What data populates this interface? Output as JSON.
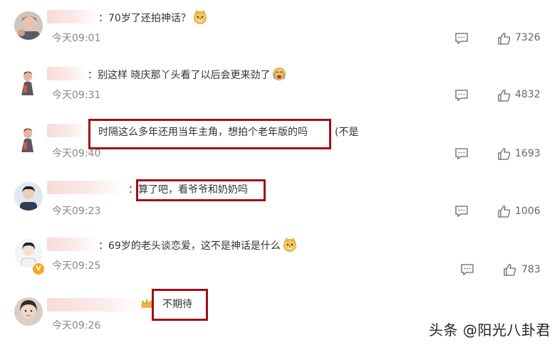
{
  "comments": [
    {
      "separator": "：",
      "text": "70岁了还拍神话？",
      "emoji": "doge-emoji",
      "time": "今天09:01",
      "likes": "7326"
    },
    {
      "separator": "：",
      "text": "别这样 晓庆那丫头看了以后会更来劲了",
      "emoji": "crying-emoji",
      "time": "今天09:31",
      "likes": "4832"
    },
    {
      "separator": "",
      "text": "时隔这么多年还用当年主角，想拍个老年版的吗",
      "extra": "(不是",
      "time": "今天09:40",
      "likes": "1693"
    },
    {
      "separator": "：",
      "text": "算了吧，看爷爷和奶奶吗",
      "time": "今天09:23",
      "likes": "1006"
    },
    {
      "separator": "：",
      "text": "69岁的老头谈恋爱，这不是神话是什么",
      "emoji": "doge-emoji",
      "time": "今天09:25",
      "likes": "783",
      "verified": "V"
    },
    {
      "separator": "",
      "text": "不期待",
      "time": "今天09:26",
      "likes": ""
    }
  ],
  "watermark": "头条 @阳光八卦君",
  "colors": {
    "highlight": "#a30d16",
    "time": "#888888",
    "text": "#333333"
  }
}
